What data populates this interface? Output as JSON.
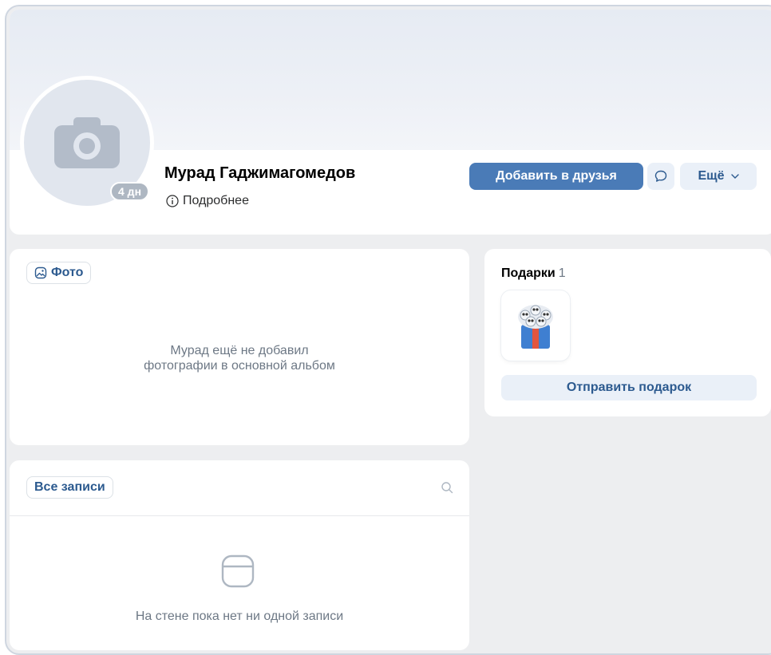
{
  "profile": {
    "name": "Мурад Гаджимагомедов",
    "more_info": "Подробнее",
    "last_seen": "4 дн"
  },
  "actions": {
    "add_friend": "Добавить в друзья",
    "more": "Ещё"
  },
  "photos": {
    "tab_label": "Фото",
    "empty_line1": "Мурад ещё не добавил",
    "empty_line2": "фотографии в основной альбом"
  },
  "gifts": {
    "title": "Подарки",
    "count": "1",
    "send_label": "Отправить подарок"
  },
  "wall": {
    "tab_label": "Все записи",
    "empty_text": "На стене пока нет ни одной записи"
  },
  "colors": {
    "accent": "#4a7bb7",
    "link": "#2c5a8f",
    "secondary_button": "#eaf0f8",
    "page_bg": "#edeef0"
  },
  "icons": {
    "avatar_placeholder": "camera-icon",
    "info": "info-icon",
    "message": "message-bubble-icon",
    "more_chevron": "chevron-down-icon",
    "photos": "image-icon",
    "wall_search": "search-icon",
    "wall_empty": "empty-post-icon"
  }
}
